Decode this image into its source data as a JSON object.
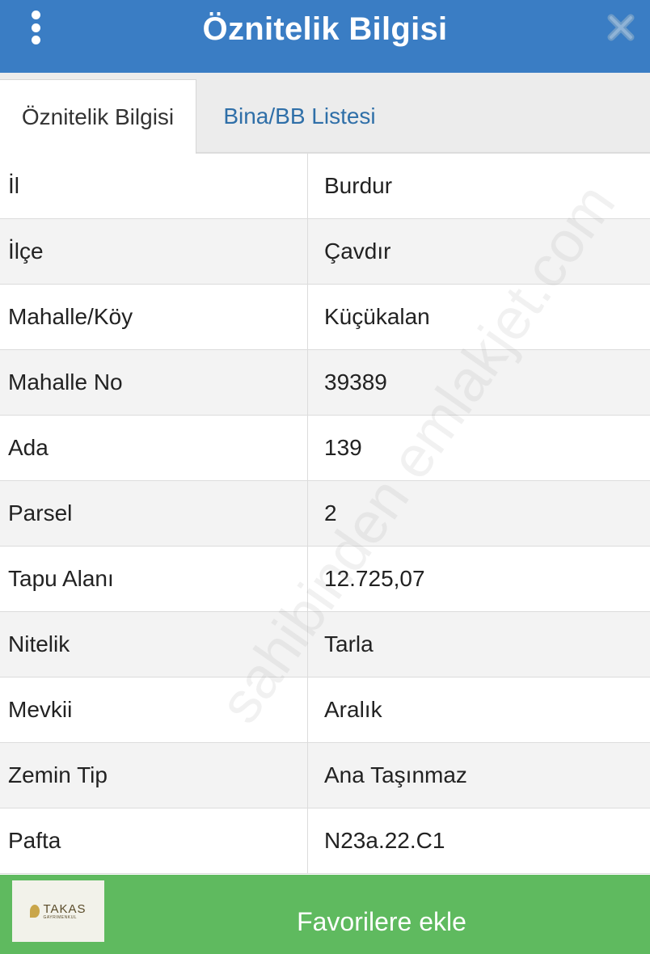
{
  "header": {
    "title": "Öznitelik Bilgisi",
    "menu_icon": "vertical-dots-icon",
    "close_icon": "close-icon"
  },
  "tabs": [
    {
      "label": "Öznitelik Bilgisi",
      "active": true
    },
    {
      "label": "Bina/BB Listesi",
      "active": false
    }
  ],
  "attributes": [
    {
      "key": "İl",
      "value": "Burdur"
    },
    {
      "key": "İlçe",
      "value": "Çavdır"
    },
    {
      "key": "Mahalle/Köy",
      "value": "Küçükalan"
    },
    {
      "key": "Mahalle No",
      "value": "39389"
    },
    {
      "key": "Ada",
      "value": "139"
    },
    {
      "key": "Parsel",
      "value": "2"
    },
    {
      "key": "Tapu Alanı",
      "value": "12.725,07"
    },
    {
      "key": "Nitelik",
      "value": "Tarla"
    },
    {
      "key": "Mevkii",
      "value": "Aralık"
    },
    {
      "key": "Zemin Tip",
      "value": "Ana Taşınmaz"
    },
    {
      "key": "Pafta",
      "value": "N23a.22.C1"
    }
  ],
  "watermark": "sahibinden emlakjet.com",
  "footer": {
    "logo_main": "TAKAS",
    "logo_sub": "GAYRIMENKUL",
    "favorite_label": "Favorilere ekle"
  },
  "colors": {
    "header_bg": "#3a7dc4",
    "footer_bg": "#5fba5f",
    "tab_link": "#2f6fa8"
  }
}
